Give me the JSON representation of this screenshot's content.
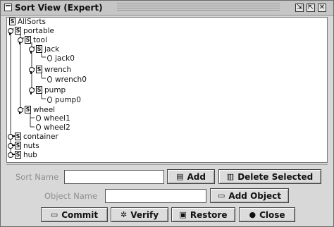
{
  "window": {
    "title": "Sort View (Expert)",
    "restore_glyph": "⇲",
    "maximize_glyph": "⇱",
    "close_glyph": "✕"
  },
  "tree": {
    "nodes": [
      {
        "label": "AllSorts",
        "icon": "sort-icon",
        "handle": "none"
      },
      {
        "label": "portable",
        "icon": "sort-icon",
        "handle": "expanded"
      },
      {
        "label": "tool",
        "icon": "sort-icon",
        "handle": "expanded"
      },
      {
        "label": "jack",
        "icon": "sort-icon",
        "handle": "expanded"
      },
      {
        "label": "jack0",
        "icon": "object-icon",
        "handle": "none"
      },
      {
        "label": "wrench",
        "icon": "sort-icon",
        "handle": "expanded"
      },
      {
        "label": "wrench0",
        "icon": "object-icon",
        "handle": "none"
      },
      {
        "label": "pump",
        "icon": "sort-icon",
        "handle": "expanded"
      },
      {
        "label": "pump0",
        "icon": "object-icon",
        "handle": "none"
      },
      {
        "label": "wheel",
        "icon": "sort-icon",
        "handle": "expanded"
      },
      {
        "label": "wheel1",
        "icon": "object-icon",
        "handle": "none"
      },
      {
        "label": "wheel2",
        "icon": "object-icon",
        "handle": "none"
      },
      {
        "label": "container",
        "icon": "sort-icon",
        "handle": "collapsed"
      },
      {
        "label": "nuts",
        "icon": "sort-icon",
        "handle": "collapsed"
      },
      {
        "label": "hub",
        "icon": "sort-icon",
        "handle": "collapsed"
      }
    ],
    "sort_icon_glyph": "S"
  },
  "form": {
    "sort_name_label": "Sort Name",
    "sort_name_value": "",
    "object_name_label": "Object Name",
    "object_name_value": ""
  },
  "buttons": {
    "add": "Add",
    "delete_selected": "Delete Selected",
    "add_object": "Add Object",
    "commit": "Commit",
    "verify": "Verify",
    "restore": "Restore",
    "close": "Close"
  },
  "icons": {
    "add": "add-sort-icon",
    "delete": "trash-icon",
    "add_object": "add-object-icon",
    "commit": "commit-icon",
    "verify": "verify-icon",
    "restore": "restore-icon",
    "close": "close-circle-icon"
  }
}
